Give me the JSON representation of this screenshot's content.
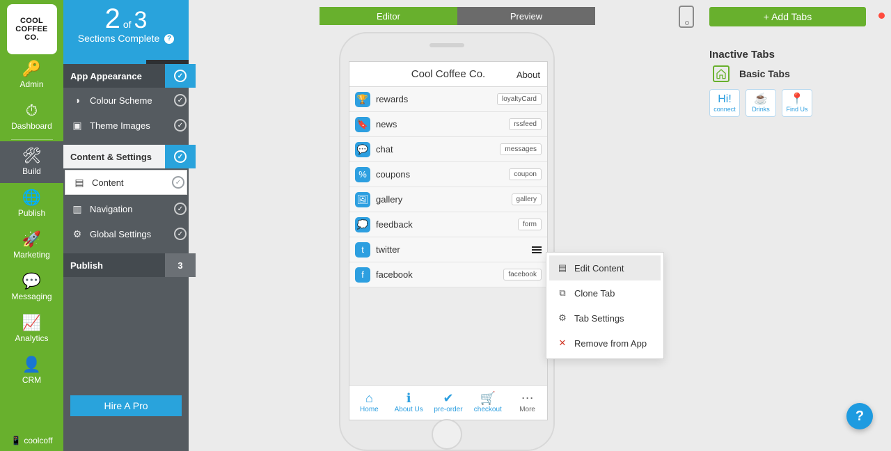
{
  "logo_lines": [
    "COOL",
    "COFFEE",
    "CO."
  ],
  "rail": {
    "items": [
      {
        "label": "Admin"
      },
      {
        "label": "Dashboard"
      },
      {
        "label": "Build"
      },
      {
        "label": "Publish"
      },
      {
        "label": "Marketing"
      },
      {
        "label": "Messaging"
      },
      {
        "label": "Analytics"
      },
      {
        "label": "CRM"
      }
    ],
    "footer": "coolcoff"
  },
  "progress": {
    "done": "2",
    "of_label": "of",
    "total": "3",
    "subtitle": "Sections Complete",
    "help": "?"
  },
  "progress_pct": 66,
  "sections": {
    "appearance": {
      "title": "App Appearance",
      "items": [
        {
          "label": "Colour Scheme"
        },
        {
          "label": "Theme Images"
        }
      ]
    },
    "content": {
      "title": "Content & Settings",
      "items": [
        {
          "label": "Content"
        },
        {
          "label": "Navigation"
        },
        {
          "label": "Global Settings"
        }
      ]
    },
    "publish": {
      "title": "Publish",
      "count": "3"
    }
  },
  "hire_btn": "Hire A Pro",
  "toggle": {
    "editor": "Editor",
    "preview": "Preview"
  },
  "app": {
    "title": "Cool Coffee Co.",
    "about": "About"
  },
  "tabs": [
    {
      "label": "rewards",
      "badge": "loyaltyCard",
      "glyph": "🏆"
    },
    {
      "label": "news",
      "badge": "rssfeed",
      "glyph": "🔖"
    },
    {
      "label": "chat",
      "badge": "messages",
      "glyph": "💬"
    },
    {
      "label": "coupons",
      "badge": "coupon",
      "glyph": "%"
    },
    {
      "label": "gallery",
      "badge": "gallery",
      "glyph": "🖼"
    },
    {
      "label": "feedback",
      "badge": "form",
      "glyph": "💭"
    },
    {
      "label": "twitter",
      "badge": "",
      "glyph": "t"
    },
    {
      "label": "facebook",
      "badge": "facebook",
      "glyph": "f"
    }
  ],
  "bottom_nav": [
    {
      "label": "Home",
      "glyph": "⌂"
    },
    {
      "label": "About Us",
      "glyph": "ℹ"
    },
    {
      "label": "pre-order",
      "glyph": "✔"
    },
    {
      "label": "checkout",
      "glyph": "🛒"
    },
    {
      "label": "More",
      "glyph": "⋯"
    }
  ],
  "ctx": [
    {
      "label": "Edit Content",
      "icon": "▤"
    },
    {
      "label": "Clone Tab",
      "icon": "⧉"
    },
    {
      "label": "Tab Settings",
      "icon": "⚙"
    },
    {
      "label": "Remove from App",
      "icon": "✕"
    }
  ],
  "right": {
    "add": "+ Add Tabs",
    "inactive_title": "Inactive Tabs",
    "basic": "Basic Tabs",
    "slots": [
      {
        "label": "connect",
        "glyph": "Hi!"
      },
      {
        "label": "Drinks",
        "glyph": "☕"
      },
      {
        "label": "Find Us",
        "glyph": "📍"
      }
    ]
  }
}
